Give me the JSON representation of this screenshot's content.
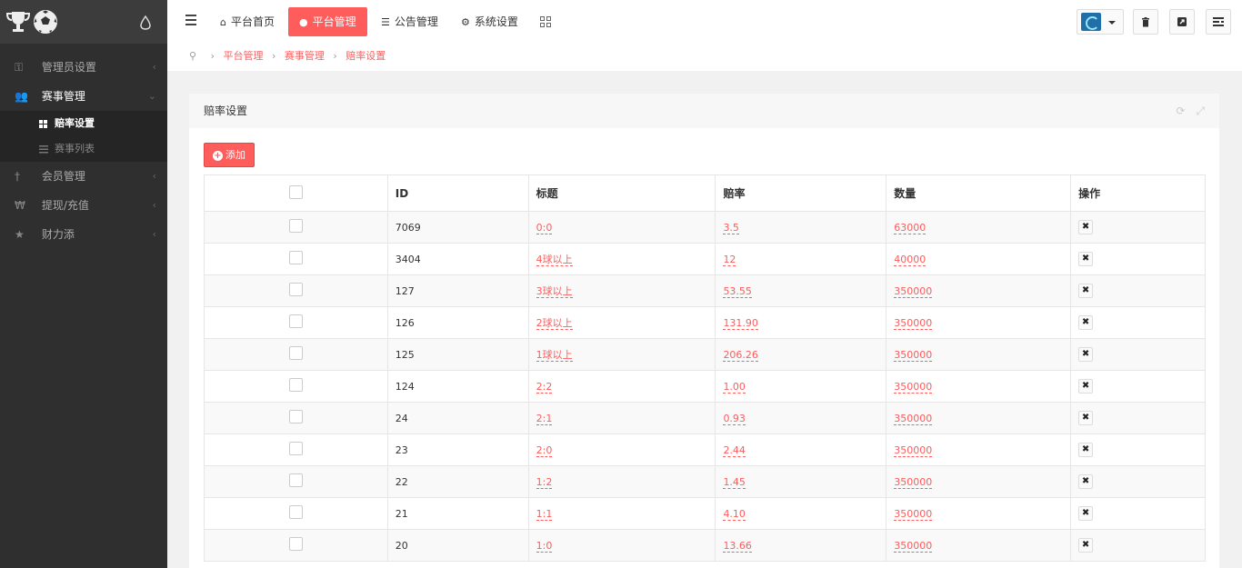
{
  "sidebar": {
    "items": [
      {
        "label": "管理员设置",
        "icon": "key-icon",
        "glyph": "⚿",
        "open": false
      },
      {
        "label": "赛事管理",
        "icon": "users-icon",
        "glyph": "👥",
        "open": true,
        "children": [
          {
            "label": "赔率设置",
            "icon": "grid-icon",
            "active": true
          },
          {
            "label": "赛事列表",
            "icon": "list-icon",
            "active": false
          }
        ]
      },
      {
        "label": "会员管理",
        "icon": "user-icon",
        "glyph": "†",
        "open": false
      },
      {
        "label": "提现/充值",
        "icon": "won-icon",
        "glyph": "₩",
        "open": false
      },
      {
        "label": "财力添",
        "icon": "star-icon",
        "glyph": "★",
        "open": false
      }
    ]
  },
  "topbar": {
    "tabs": [
      {
        "label": "平台首页",
        "icon": "home-icon",
        "glyph": "⌂",
        "active": false
      },
      {
        "label": "平台管理",
        "icon": "user-icon",
        "glyph": "●",
        "active": true
      },
      {
        "label": "公告管理",
        "icon": "list-icon",
        "glyph": "☰",
        "active": false
      },
      {
        "label": "系统设置",
        "icon": "gear-icon",
        "glyph": "⚙",
        "active": false
      }
    ]
  },
  "breadcrumb": [
    "平台管理",
    "赛事管理",
    "赔率设置"
  ],
  "panel": {
    "title": "赔率设置",
    "add_label": "添加"
  },
  "table": {
    "columns": [
      "ID",
      "标题",
      "赔率",
      "数量",
      "操作"
    ],
    "rows": [
      {
        "id": "7069",
        "title": "0:0",
        "odds": "3.5",
        "qty": "63000"
      },
      {
        "id": "3404",
        "title": "4球以上",
        "odds": "12",
        "qty": "40000"
      },
      {
        "id": "127",
        "title": "3球以上",
        "odds": "53.55",
        "qty": "350000"
      },
      {
        "id": "126",
        "title": "2球以上",
        "odds": "131.90",
        "qty": "350000"
      },
      {
        "id": "125",
        "title": "1球以上",
        "odds": "206.26",
        "qty": "350000"
      },
      {
        "id": "124",
        "title": "2:2",
        "odds": "1.00",
        "qty": "350000"
      },
      {
        "id": "24",
        "title": "2:1",
        "odds": "0.93",
        "qty": "350000"
      },
      {
        "id": "23",
        "title": "2:0",
        "odds": "2.44",
        "qty": "350000"
      },
      {
        "id": "22",
        "title": "1:2",
        "odds": "1.45",
        "qty": "350000"
      },
      {
        "id": "21",
        "title": "1:1",
        "odds": "4.10",
        "qty": "350000"
      },
      {
        "id": "20",
        "title": "1:0",
        "odds": "13.66",
        "qty": "350000"
      }
    ],
    "delete_glyph": "✖"
  },
  "colors": {
    "accent": "#ff5c5c",
    "sidebar_bg": "#2f2f2f"
  }
}
